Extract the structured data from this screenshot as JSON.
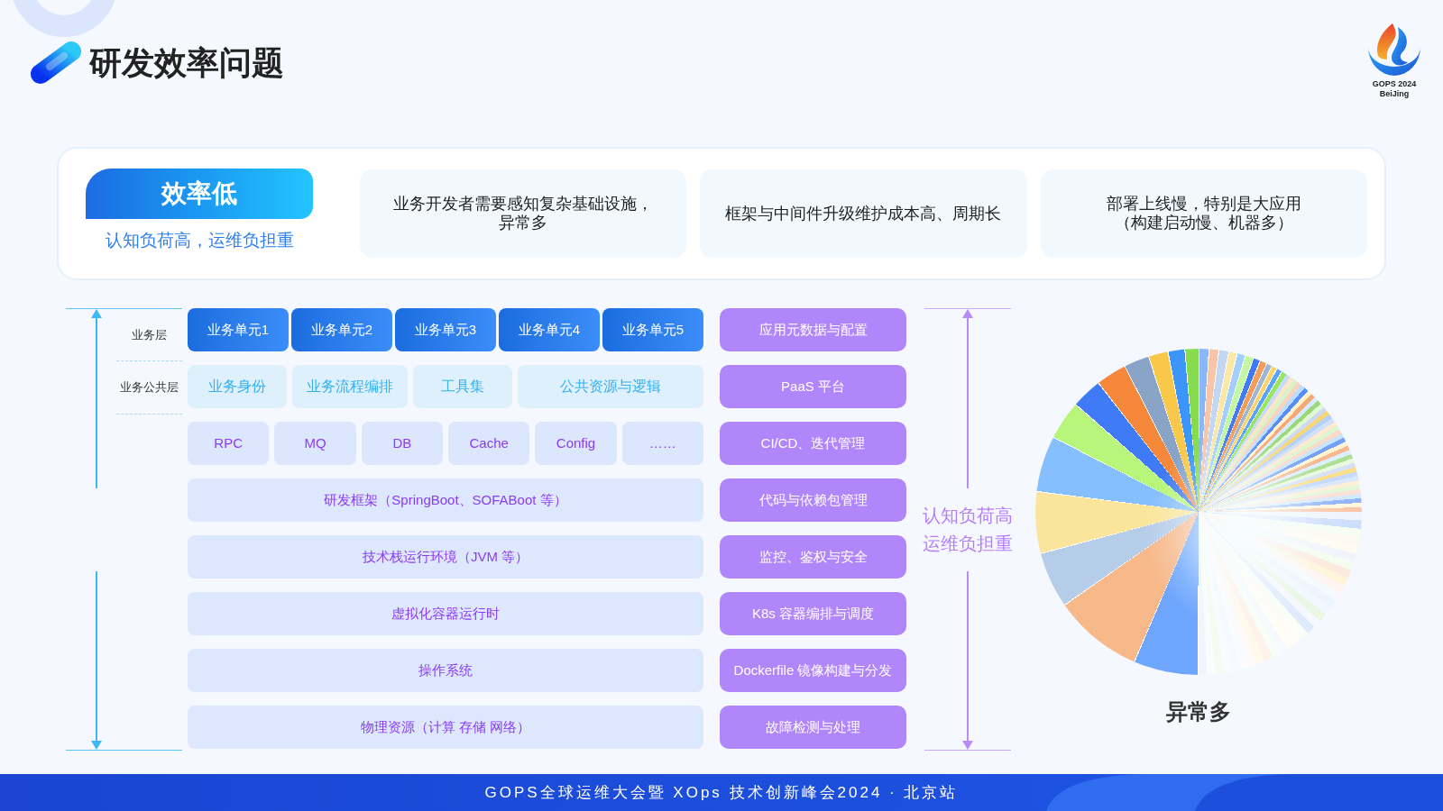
{
  "header": {
    "title": "研发效率问题"
  },
  "event_logo": {
    "lines": [
      "GOPS 2024",
      "BeiJing"
    ]
  },
  "summary": {
    "badge": "效率低",
    "subtitle": "认知负荷高，运维负担重",
    "problems": [
      {
        "lines": [
          "业务开发者需要感知复杂基础设施，",
          "异常多"
        ]
      },
      {
        "lines": [
          "框架与中间件升级维护成本高、周期长"
        ]
      },
      {
        "lines": [
          "部署上线慢，特别是大应用",
          "（构建启动慢、机器多）"
        ]
      }
    ]
  },
  "stack": {
    "layer_labels": [
      "业务层",
      "业务公共层"
    ],
    "layers": [
      {
        "kind": "unit",
        "items": [
          "业务单元1",
          "业务单元2",
          "业务单元3",
          "业务单元4",
          "业务单元5"
        ]
      },
      {
        "kind": "common",
        "items": [
          "业务身份",
          "业务流程编排",
          "工具集",
          "公共资源与逻辑"
        ]
      },
      {
        "kind": "middleware",
        "items": [
          "RPC",
          "MQ",
          "DB",
          "Cache",
          "Config",
          "……"
        ]
      },
      {
        "kind": "base",
        "items": [
          "研发框架（SpringBoot、SOFABoot 等）"
        ]
      },
      {
        "kind": "base",
        "items": [
          "技术栈运行环境（JVM 等）"
        ]
      },
      {
        "kind": "base",
        "items": [
          "虚拟化容器运行时"
        ]
      },
      {
        "kind": "base",
        "items": [
          "操作系统"
        ]
      },
      {
        "kind": "base",
        "items": [
          "物理资源（计算 存储 网络）"
        ]
      }
    ]
  },
  "concerns": [
    "应用元数据与配置",
    "PaaS 平台",
    "CI/CD、迭代管理",
    "代码与依赖包管理",
    "监控、鉴权与安全",
    "K8s 容器编排与调度",
    "Dockerfile 镜像构建与分发",
    "故障检测与处理"
  ],
  "load_note": {
    "lines": [
      "认知负荷高",
      "运维负担重"
    ]
  },
  "pie": {
    "caption": "异常多"
  },
  "footer": {
    "text": "GOPS全球运维大会暨 XOps 技术创新峰会2024 · 北京站"
  }
}
